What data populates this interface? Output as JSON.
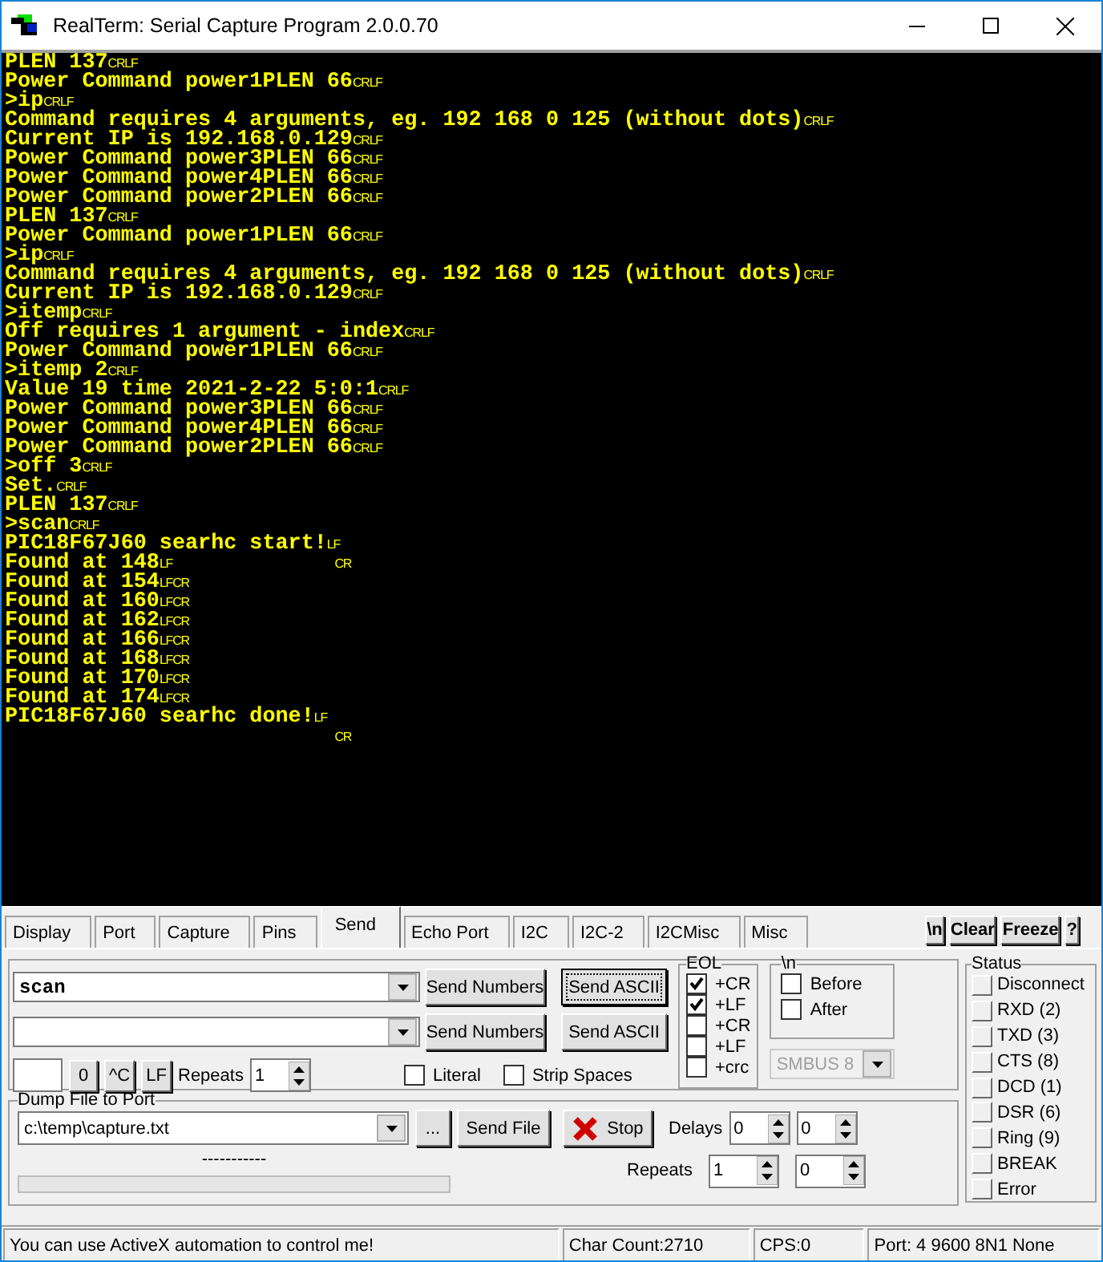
{
  "window": {
    "title": "RealTerm: Serial Capture Program 2.0.0.70"
  },
  "terminal": {
    "lines": [
      {
        "text": "PLEN 137",
        "eol": "CRLF"
      },
      {
        "text": "Power Command power1PLEN 66",
        "eol": "CRLF"
      },
      {
        "text": ">ip",
        "eol": "CRLF"
      },
      {
        "text": "Command requires 4 arguments, eg. 192 168 0 125 (without dots)",
        "eol": "CRLF"
      },
      {
        "text": "Current IP is 192.168.0.129",
        "eol": "CRLF"
      },
      {
        "text": "Power Command power3PLEN 66",
        "eol": "CRLF"
      },
      {
        "text": "Power Command power4PLEN 66",
        "eol": "CRLF"
      },
      {
        "text": "Power Command power2PLEN 66",
        "eol": "CRLF"
      },
      {
        "text": "PLEN 137",
        "eol": "CRLF"
      },
      {
        "text": "Power Command power1PLEN 66",
        "eol": "CRLF"
      },
      {
        "text": ">ip",
        "eol": "CRLF"
      },
      {
        "text": "Command requires 4 arguments, eg. 192 168 0 125 (without dots)",
        "eol": "CRLF"
      },
      {
        "text": "Current IP is 192.168.0.129",
        "eol": "CRLF"
      },
      {
        "text": ">itemp",
        "eol": "CRLF"
      },
      {
        "text": "Off requires 1 argument - index",
        "eol": "CRLF"
      },
      {
        "text": "Power Command power1PLEN 66",
        "eol": "CRLF"
      },
      {
        "text": ">itemp 2",
        "eol": "CRLF"
      },
      {
        "text": "Value 19 time 2021-2-22 5:0:1",
        "eol": "CRLF"
      },
      {
        "text": "Power Command power3PLEN 66",
        "eol": "CRLF"
      },
      {
        "text": "Power Command power4PLEN 66",
        "eol": "CRLF"
      },
      {
        "text": "Power Command power2PLEN 66",
        "eol": "CRLF"
      },
      {
        "text": ">off 3",
        "eol": "CRLF"
      },
      {
        "text": "Set.",
        "eol": "CRLF"
      },
      {
        "text": "PLEN 137",
        "eol": "CRLF"
      },
      {
        "text": ">scan",
        "eol": "CRLF"
      },
      {
        "text": "PIC18F67J60 searhc start!",
        "eol": "LF"
      },
      {
        "text": "Found at 148",
        "eol": "LF",
        "stray": "CR"
      },
      {
        "text": "Found at 154",
        "eol": "LFCR"
      },
      {
        "text": "Found at 160",
        "eol": "LFCR"
      },
      {
        "text": "Found at 162",
        "eol": "LFCR"
      },
      {
        "text": "Found at 166",
        "eol": "LFCR"
      },
      {
        "text": "Found at 168",
        "eol": "LFCR"
      },
      {
        "text": "Found at 170",
        "eol": "LFCR"
      },
      {
        "text": "Found at 174",
        "eol": "LFCR"
      },
      {
        "text": "PIC18F67J60 searhc done!",
        "eol": "LF"
      },
      {
        "stray": "CR"
      }
    ]
  },
  "tabs": [
    {
      "label": "Display",
      "selected": false
    },
    {
      "label": "Port",
      "selected": false
    },
    {
      "label": "Capture",
      "selected": false
    },
    {
      "label": "Pins",
      "selected": false
    },
    {
      "label": "Send",
      "selected": true
    },
    {
      "label": "Echo Port",
      "selected": false
    },
    {
      "label": "I2C",
      "selected": false
    },
    {
      "label": "I2C-2",
      "selected": false
    },
    {
      "label": "I2CMisc",
      "selected": false
    },
    {
      "label": "Misc",
      "selected": false
    }
  ],
  "toolbar_buttons": [
    "\\n",
    "Clear",
    "Freeze",
    "?"
  ],
  "send_rows": [
    {
      "value": "scan",
      "numbers_button": "Send Numbers",
      "ascii_button": "Send ASCII",
      "focused": true
    },
    {
      "numbers_button": "Send Numbers",
      "ascii_button": "Send ASCII",
      "focused": false
    }
  ],
  "char_row": {
    "buttons": [
      "0",
      "^C",
      "LF"
    ],
    "repeats_label": "Repeats",
    "repeats_value": "1"
  },
  "literal": {
    "label": "Literal",
    "checked": false
  },
  "strip_spaces": {
    "label": "Strip Spaces",
    "checked": false
  },
  "eol": {
    "title": "EOL",
    "options": [
      {
        "label": "+CR",
        "checked": true
      },
      {
        "label": "+LF",
        "checked": true
      },
      {
        "label": "+CR",
        "checked": false
      },
      {
        "label": "+LF",
        "checked": false
      },
      {
        "label": "+crc",
        "checked": false
      }
    ]
  },
  "newline": {
    "title": "\\n",
    "options": [
      {
        "label": "Before",
        "checked": false
      },
      {
        "label": "After",
        "checked": false
      }
    ]
  },
  "smbus": {
    "value": "SMBUS 8",
    "disabled": true
  },
  "dump": {
    "title": "Dump File to Port",
    "file": "c:\\temp\\capture.txt",
    "browse_button": "...",
    "send_file_button": "Send File",
    "stop_button": "Stop",
    "delays_label": "Delays",
    "delays": [
      "0",
      "0"
    ],
    "progress_label": "-----------",
    "level": 0,
    "repeats_label": "Repeats",
    "repeats": [
      "1",
      "0"
    ]
  },
  "status": {
    "title": "Status",
    "indicators": [
      {
        "label": "Disconnect",
        "on": false
      },
      {
        "label": "RXD (2)",
        "on": false
      },
      {
        "label": "TXD (3)",
        "on": false
      },
      {
        "label": "CTS (8)",
        "on": false
      },
      {
        "label": "DCD (1)",
        "on": false
      },
      {
        "label": "DSR (6)",
        "on": false
      },
      {
        "label": "Ring (9)",
        "on": false
      },
      {
        "label": "BREAK",
        "on": false
      },
      {
        "label": "Error",
        "on": false
      }
    ]
  },
  "status_bar": [
    "You can use ActiveX automation to control me!",
    "Char Count:2710",
    "CPS:0",
    "Port: 4 9600 8N1 None"
  ]
}
